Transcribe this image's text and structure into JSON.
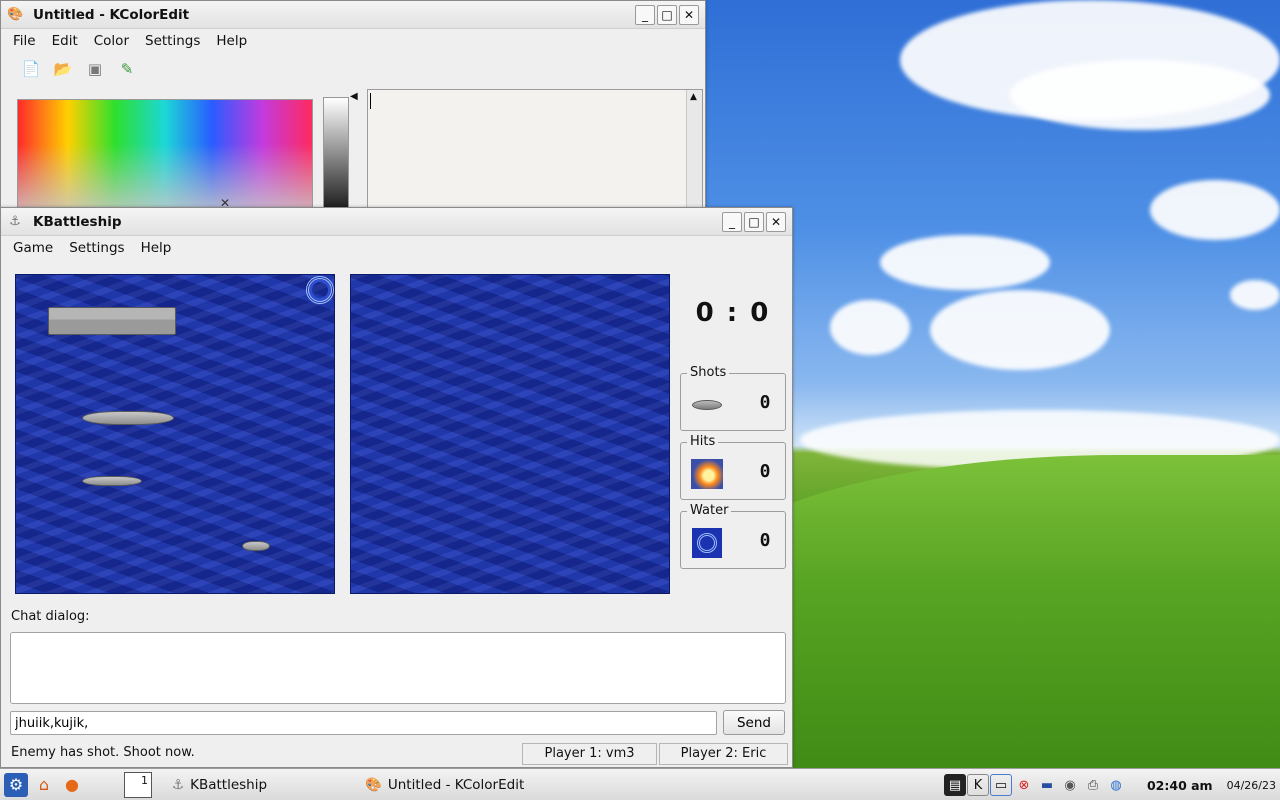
{
  "kcoloredit": {
    "title": "Untitled - KColorEdit",
    "menu": [
      "File",
      "Edit",
      "Color",
      "Settings",
      "Help"
    ],
    "toolbar_icons": [
      "new-file-icon",
      "open-folder-icon",
      "save-icon",
      "color-picker-icon"
    ]
  },
  "kbattleship": {
    "title": "KBattleship",
    "menu": [
      "Game",
      "Settings",
      "Help"
    ],
    "score": "0 : 0",
    "stats": [
      {
        "label": "Shots",
        "value": "0"
      },
      {
        "label": "Hits",
        "value": "0"
      },
      {
        "label": "Water",
        "value": "0"
      }
    ],
    "chat_label": "Chat dialog:",
    "chat_input_value": "jhuiik,kujik,",
    "send_label": "Send",
    "status": {
      "message": "Enemy has shot. Shoot now.",
      "player1": "Player 1: vm3",
      "player2": "Player 2: Eric"
    }
  },
  "taskbar": {
    "pager_number": "1",
    "tasks": [
      "KBattleship",
      "Untitled - KColorEdit"
    ],
    "clock": "02:40 am",
    "date": "04/26/23"
  },
  "colors": {
    "ocean": "#1a2fa8",
    "window_bg": "#efefef"
  }
}
